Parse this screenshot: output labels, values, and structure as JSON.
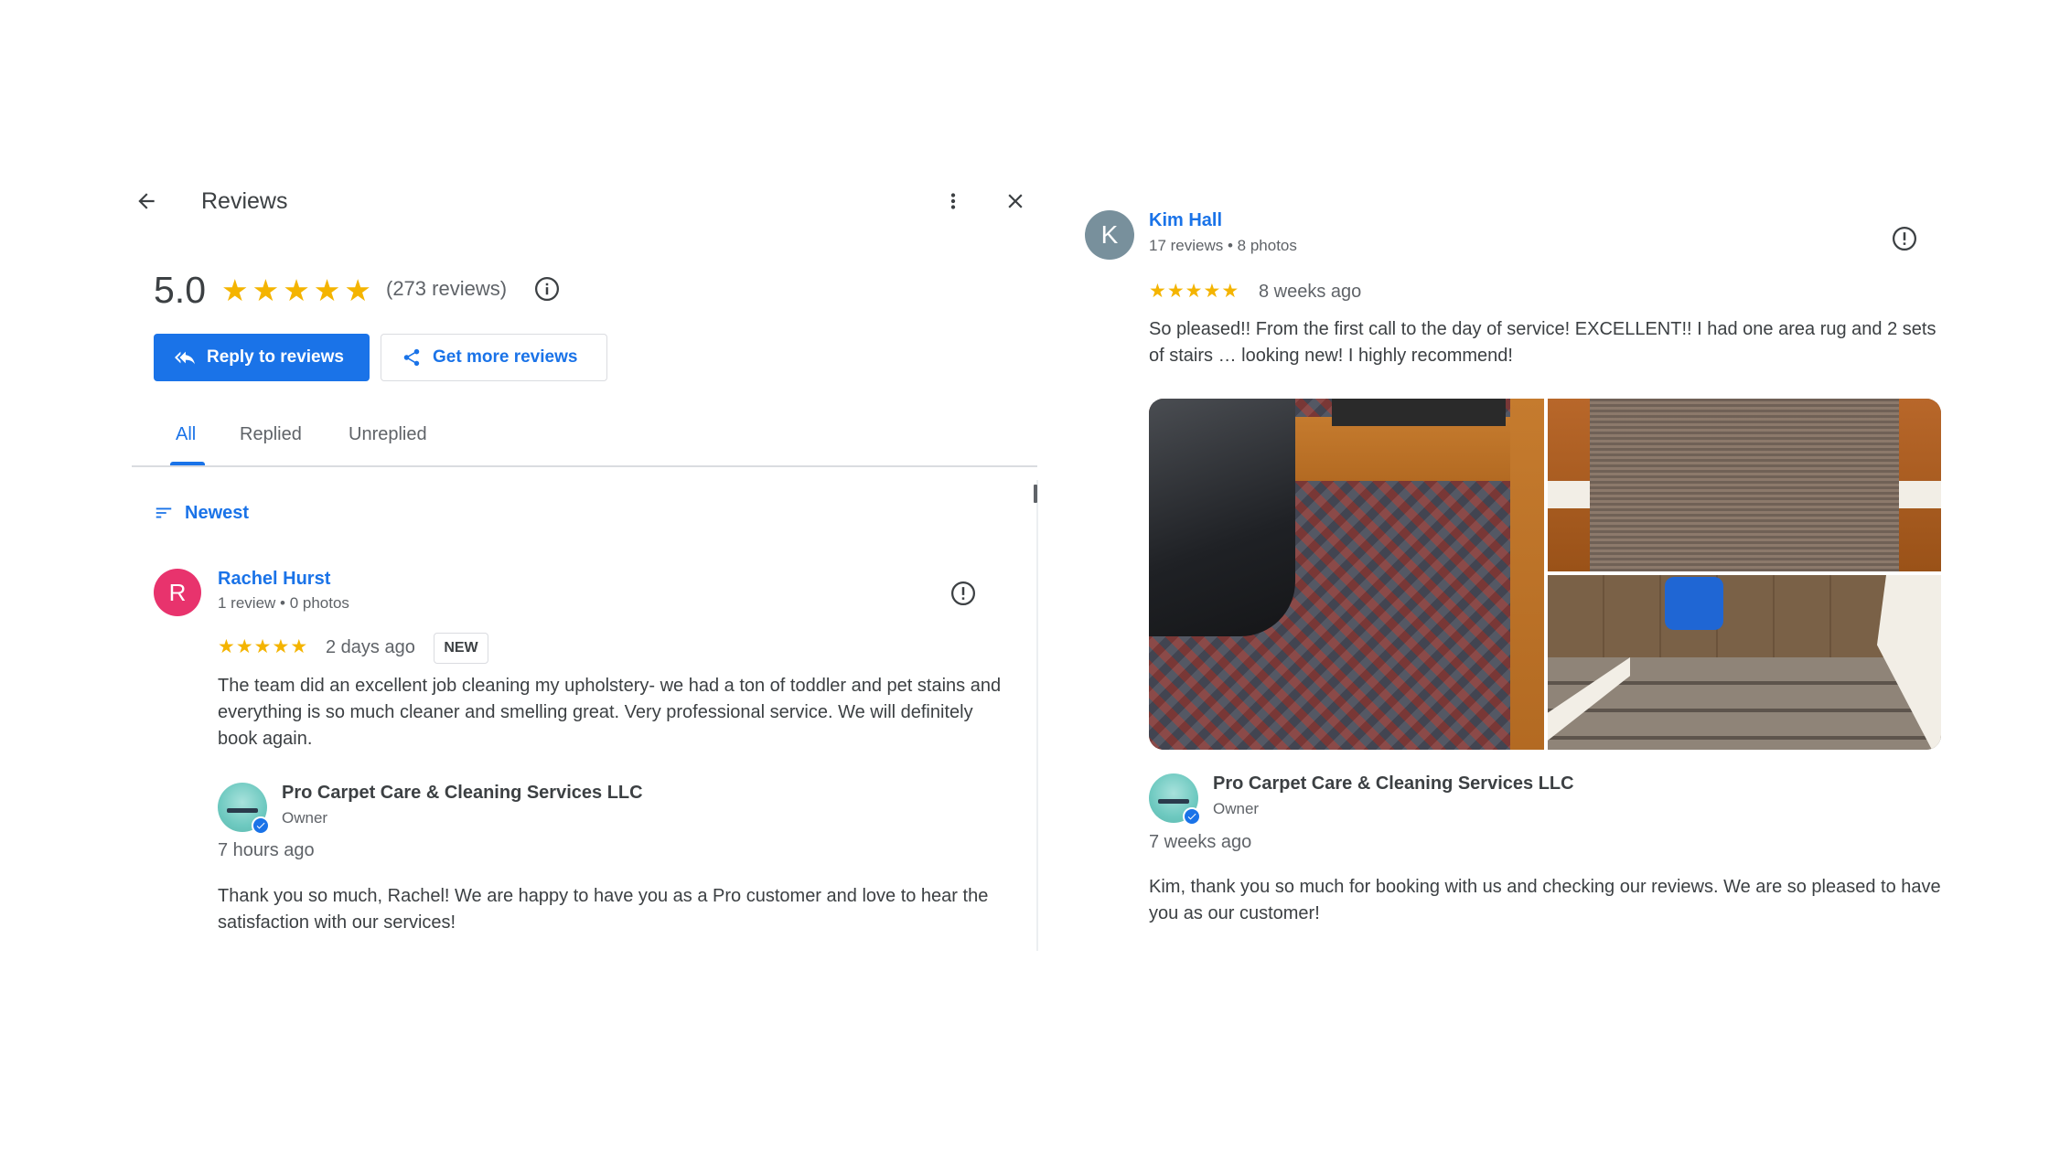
{
  "left_panel": {
    "header": {
      "title": "Reviews"
    },
    "summary": {
      "rating": "5.0",
      "stars": [
        "★",
        "★",
        "★",
        "★",
        "★"
      ],
      "count_text": "(273 reviews)"
    },
    "actions": {
      "reply_label": "Reply to reviews",
      "get_more_label": "Get more reviews"
    },
    "tabs": [
      {
        "label": "All",
        "active": true
      },
      {
        "label": "Replied",
        "active": false
      },
      {
        "label": "Unreplied",
        "active": false
      }
    ],
    "sort": {
      "label": "Newest"
    },
    "review": {
      "avatar_letter": "R",
      "name": "Rachel Hurst",
      "meta": "1 review • 0 photos",
      "stars": [
        "★",
        "★",
        "★",
        "★",
        "★"
      ],
      "date": "2 days ago",
      "badge": "NEW",
      "text": "The team did an excellent job cleaning my upholstery- we had a ton of toddler and pet stains and everything is so much cleaner and smelling great. Very professional service. We will definitely book again.",
      "reply": {
        "owner_name": "Pro Carpet Care & Cleaning Services LLC",
        "owner_role": "Owner",
        "date": "7 hours ago",
        "text": "Thank you so much, Rachel! We are happy to have you as a Pro customer and love to hear the satisfaction with our services!"
      }
    }
  },
  "right_panel": {
    "review": {
      "avatar_letter": "K",
      "name": "Kim Hall",
      "meta": "17 reviews • 8 photos",
      "stars": [
        "★",
        "★",
        "★",
        "★",
        "★"
      ],
      "date": "8 weeks ago",
      "text": "So pleased!! From the first call to the day of service! EXCELLENT!! I had one area rug and 2 sets of stairs … looking new! I highly recommend!",
      "photos": [
        "area-rug-photo",
        "stair-runner-photo",
        "stairs-with-blower-photo"
      ],
      "reply": {
        "owner_name": "Pro Carpet Care & Cleaning Services LLC",
        "owner_role": "Owner",
        "date": "7 weeks ago",
        "text": "Kim, thank you so much for booking with us and checking our reviews. We are so pleased to have you as our customer!"
      }
    }
  },
  "colors": {
    "accent": "#1a73e8",
    "star": "#f4b400",
    "avatar_r": "#e8336d",
    "avatar_k": "#78909c",
    "text_secondary": "#5f6368"
  }
}
